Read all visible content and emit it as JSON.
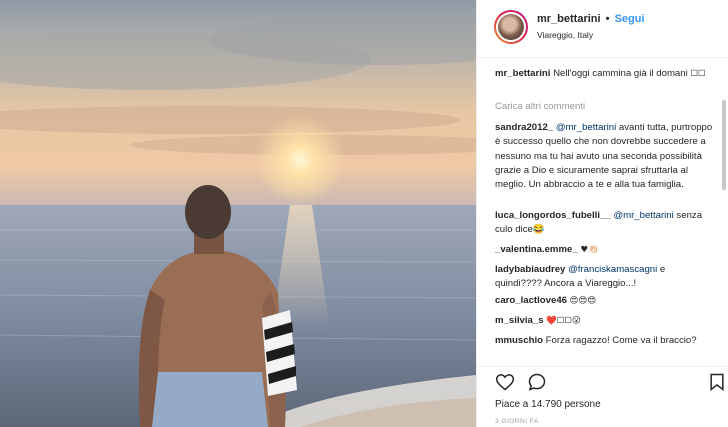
{
  "post": {
    "username": "mr_bettarini",
    "separator": "•",
    "follow_label": "Segui",
    "location": "Viareggio, Italy",
    "caption_user": "mr_bettarini",
    "caption_text": "Nell'oggi cammina già il domani",
    "caption_emoji": "☐☐",
    "load_more": "Carica altri commenti",
    "likes": "Piace a 14.790 persone",
    "time": "3 GIORNI FA"
  },
  "comments": [
    {
      "user": "sandra2012_",
      "mention": "@mr_bettarini",
      "text": " avanti tutta, purtroppo è successo quello che non dovrebbe succedere a nessuno ma tu hai avuto una seconda possibilità grazie a Dio e sicuramente saprai sfruttarla al meglio. Un abbraccio a te e alla tua famiglia."
    },
    {
      "user": "luca_longordos_fubelli__",
      "mention": "@mr_bettarini",
      "text": " senza culo dice😂"
    },
    {
      "user": "_valentina.emme_",
      "mention": "",
      "text": " ♥👏🏻"
    },
    {
      "user": "ladybabiaudrey",
      "mention": "@franciskamascagni",
      "text": " e quindi???? Ancora a Viareggio...!"
    },
    {
      "user": "caro_lactlove46",
      "mention": "",
      "text": " 😍😍😍"
    },
    {
      "user": "m_silvia_s",
      "mention": "",
      "text": " ❤️☐☐😮"
    },
    {
      "user": "mmuschio",
      "mention": "",
      "text": " Forza ragazzo! Come va il braccio?"
    }
  ],
  "icons": [
    "heart-icon",
    "comment-icon",
    "bookmark-icon"
  ],
  "colors": {
    "link": "#3897f0",
    "mention": "#003569",
    "muted": "#999999",
    "text": "#262626"
  }
}
